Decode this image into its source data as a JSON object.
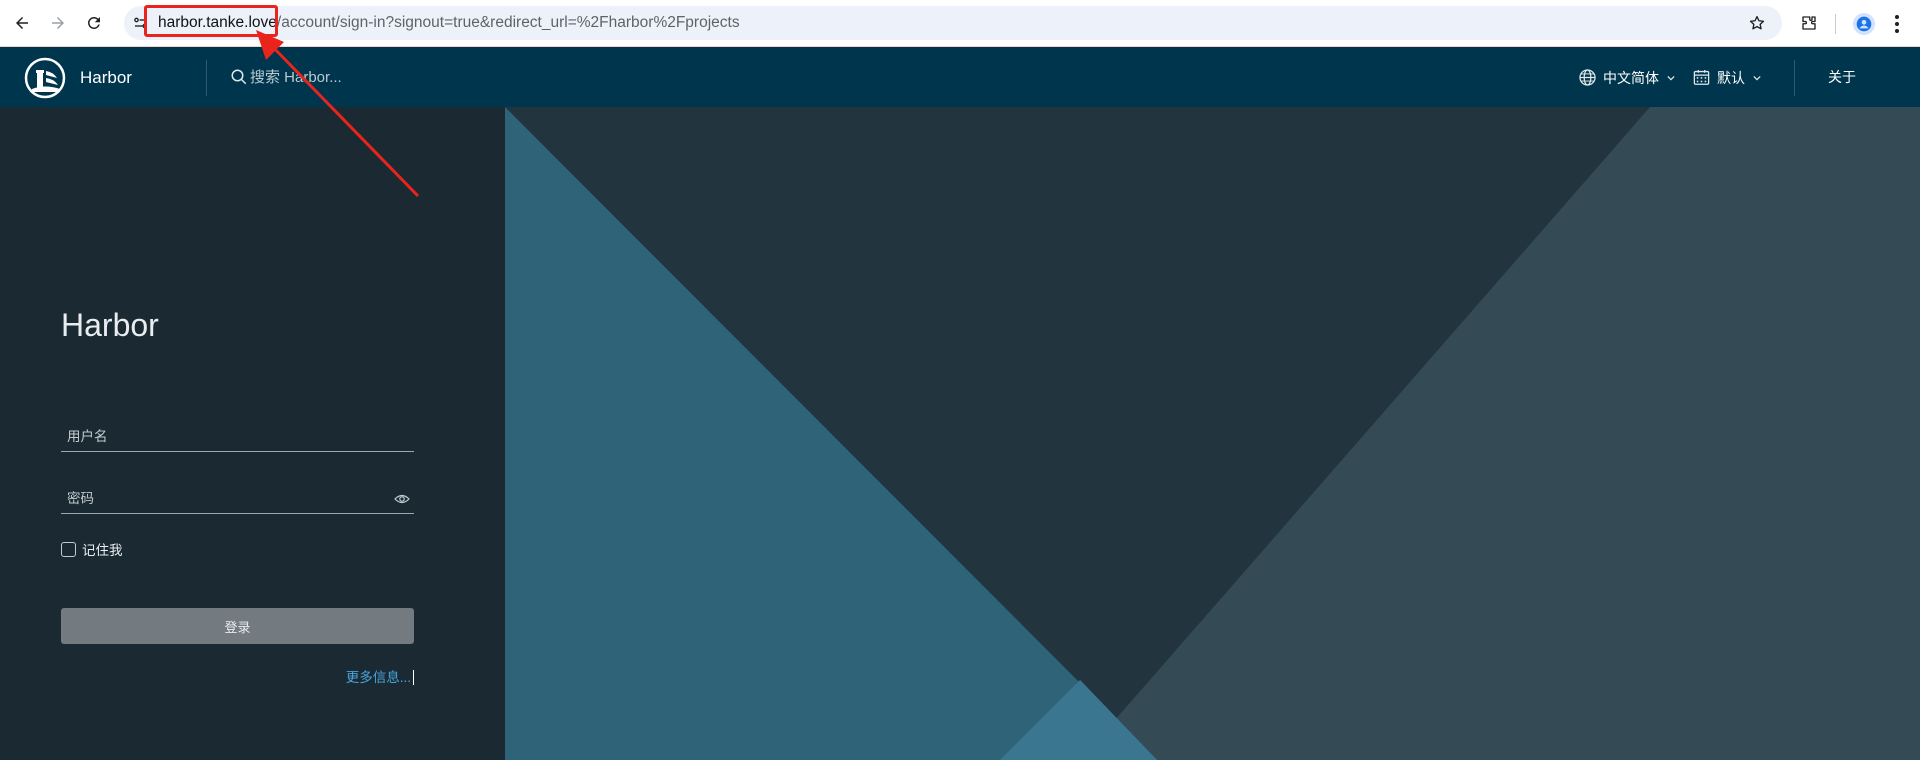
{
  "browser": {
    "url_host": "harbor.tanke.love",
    "url_path": "/account/sign-in?signout=true&redirect_url=%2Fharbor%2Fprojects"
  },
  "header": {
    "brand": "Harbor",
    "search_placeholder": "搜索 Harbor...",
    "language": "中文简体",
    "theme": "默认",
    "about": "关于"
  },
  "login": {
    "title": "Harbor",
    "username_placeholder": "用户名",
    "password_placeholder": "密码",
    "remember_me": "记住我",
    "login_button": "登录",
    "more_info": "更多信息..."
  },
  "colors": {
    "header_bg": "#00364d",
    "panel_bg": "#1b2a32",
    "button_disabled": "#737b80",
    "link": "#49a3dd",
    "highlight": "#e8241c"
  }
}
